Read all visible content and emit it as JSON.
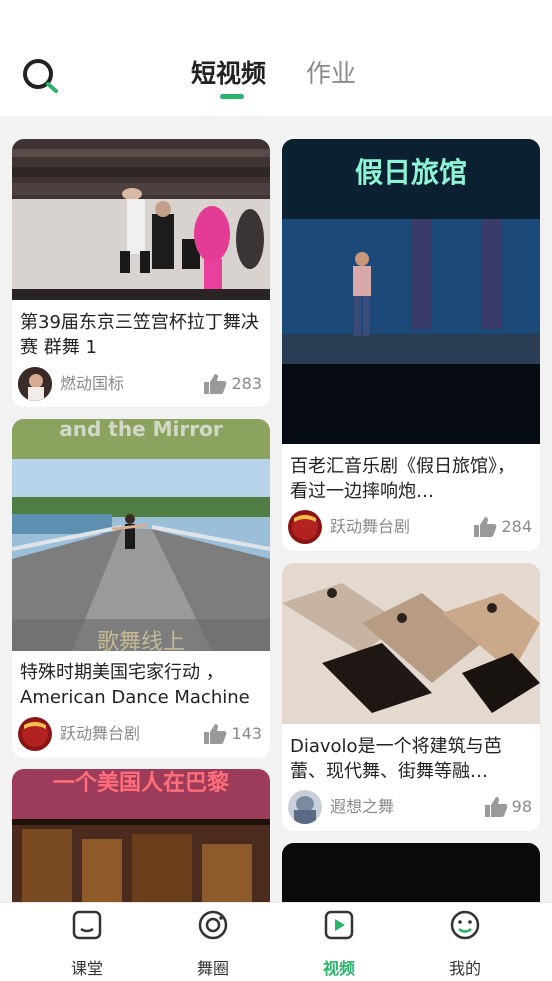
{
  "header": {
    "tabs": [
      {
        "label": "短视频",
        "active": true
      },
      {
        "label": "作业",
        "active": false
      }
    ]
  },
  "feed": {
    "left": [
      {
        "title": "第39届东京三笠宫杯拉丁舞决赛 群舞 1",
        "author": "燃动国标",
        "likes": "283",
        "thumb": "latin-dance-competition"
      },
      {
        "title": "特殊时期美国宅家行动 ，American Dance Machine",
        "author": "跃动舞台剧",
        "likes": "143",
        "thumb": "dance-on-road",
        "overlay_top": "and the Mirror",
        "overlay_bottom": "歌舞线上"
      },
      {
        "title": "",
        "author": "",
        "likes": "",
        "thumb": "stage-paris",
        "overlay_top": "一个美国人在巴黎"
      }
    ],
    "right": [
      {
        "title": "百老汇音乐剧《假日旅馆》，看过一边摔响炮…",
        "author": "跃动舞台剧",
        "likes": "284",
        "thumb": "holiday-inn",
        "overlay_top": "假日旅馆"
      },
      {
        "title": "Diavolo是一个将建筑与芭蕾、现代舞、街舞等融…",
        "author": "遐想之舞",
        "likes": "98",
        "thumb": "diavolo-architecture"
      },
      {
        "title": "",
        "author": "",
        "likes": "",
        "thumb": "dark-stage"
      }
    ]
  },
  "bottom_nav": [
    {
      "label": "课堂",
      "icon": "classroom-icon",
      "active": false
    },
    {
      "label": "舞圈",
      "icon": "circle-icon",
      "active": false
    },
    {
      "label": "视频",
      "icon": "video-icon",
      "active": true
    },
    {
      "label": "我的",
      "icon": "profile-icon",
      "active": false
    }
  ],
  "colors": {
    "accent": "#2bb36b",
    "text": "#222222",
    "muted": "#8a8a8a",
    "background": "#f2f2f2"
  }
}
